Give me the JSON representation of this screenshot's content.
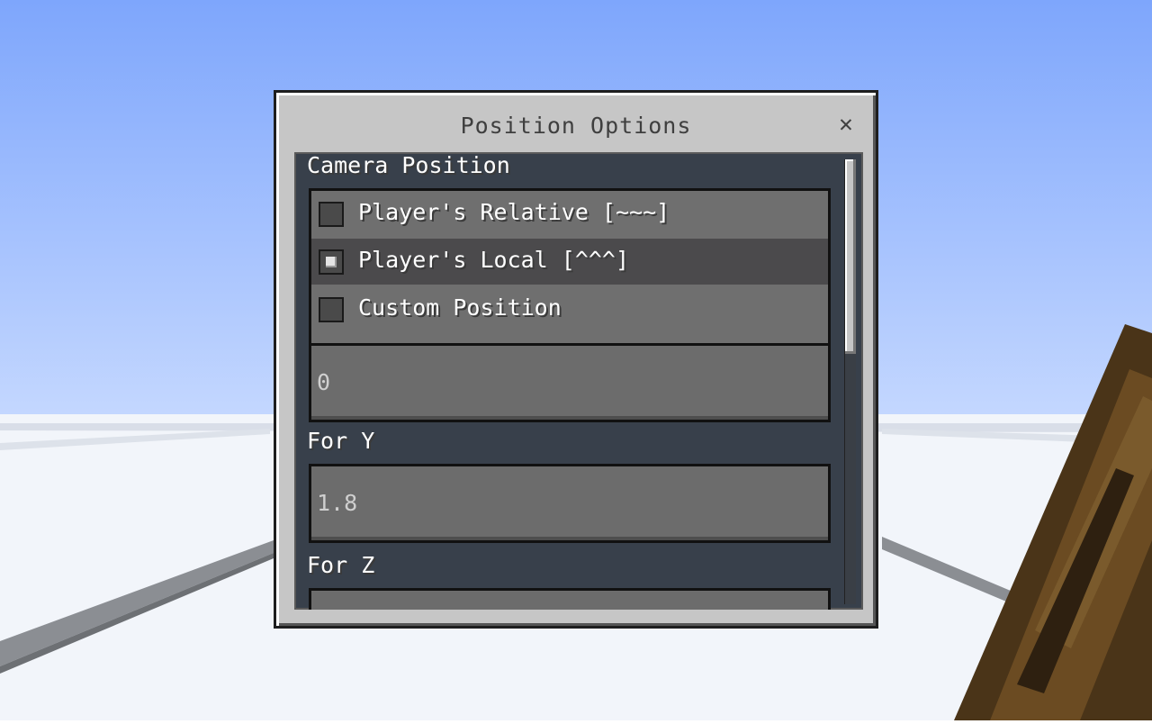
{
  "dialog": {
    "title": "Position Options",
    "close_icon": "close-icon"
  },
  "camera_section": {
    "label": "Camera Position",
    "options": [
      {
        "label": "Player's Relative [~~~]",
        "checked": false
      },
      {
        "label": "Player's Local [^^^]",
        "checked": true
      },
      {
        "label": "Custom Position",
        "checked": false
      }
    ]
  },
  "fields": {
    "x_value": "0",
    "y_label": "For Y",
    "y_value": "1.8",
    "z_label": "For Z",
    "z_value": ""
  },
  "colors": {
    "sky": "#8fb3ff",
    "snow": "#f3f6fb",
    "panel": "#c6c6c6",
    "selected_row": "#4b4a4c"
  }
}
